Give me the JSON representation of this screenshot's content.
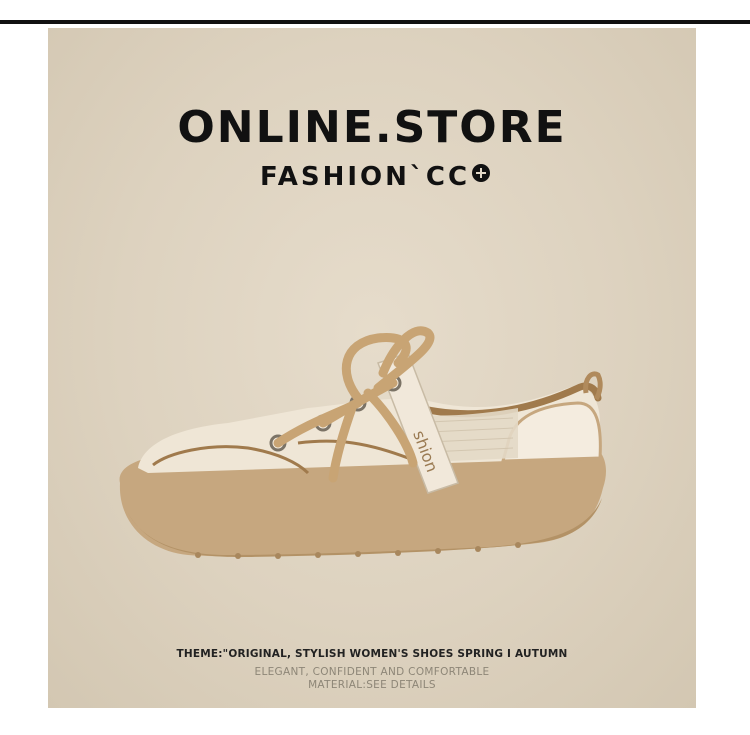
{
  "headline": "ONLINE.STORE",
  "subline": "FASHION`CC",
  "subline_icon": "plus-circle-icon",
  "shoe_tongue_text": "shion",
  "captions": {
    "theme": "THEME:\"ORIGINAL, STYLISH WOMEN'S SHOES SPRING I AUTUMN",
    "tagline": "ELEGANT, CONFIDENT AND COMFORTABLE",
    "material": "MATERIAL:SEE DETAILS"
  },
  "colors": {
    "background": "#ddd2bf",
    "text": "#111111",
    "sole": "#c6a77f",
    "upper": "#efe6d6",
    "lace": "#c8a474"
  }
}
